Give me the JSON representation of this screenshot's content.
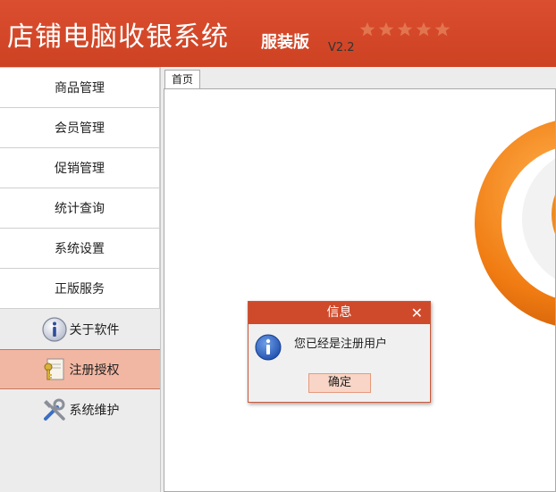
{
  "header": {
    "title": "店铺电脑收银系统",
    "edition": "服装版",
    "version": "V2.2",
    "stars": 5
  },
  "sidebar": {
    "items": [
      {
        "label": "商品管理"
      },
      {
        "label": "会员管理"
      },
      {
        "label": "促销管理"
      },
      {
        "label": "统计查询"
      },
      {
        "label": "系统设置"
      },
      {
        "label": "正版服务"
      }
    ],
    "tools": [
      {
        "label": "关于软件",
        "icon": "info-icon"
      },
      {
        "label": "注册授权",
        "icon": "key-icon",
        "active": true
      },
      {
        "label": "系统维护",
        "icon": "tools-icon"
      }
    ]
  },
  "main": {
    "tabs": [
      {
        "label": "首页"
      }
    ]
  },
  "dialog": {
    "title": "信息",
    "close_glyph": "✕",
    "message": "您已经是注册用户",
    "ok_label": "确定",
    "icon": "info-icon"
  },
  "colors": {
    "brand": "#cf4a2b",
    "active_item": "#f2b7a2",
    "logo_orange": "#f07b12"
  }
}
